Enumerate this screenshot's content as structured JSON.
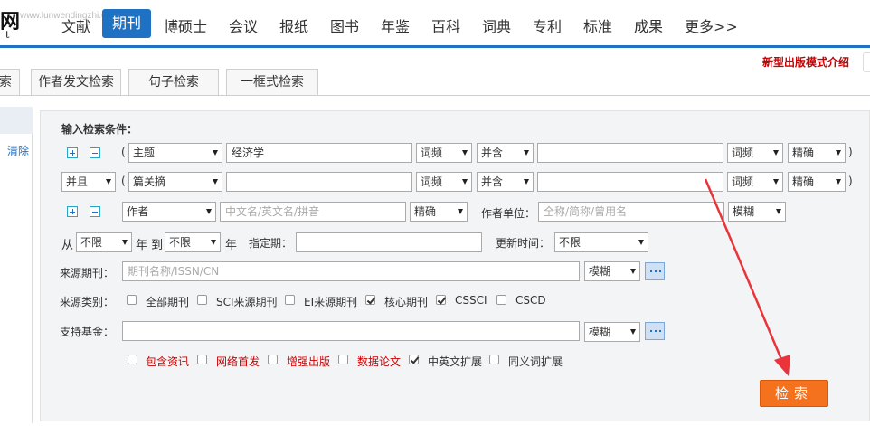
{
  "watermark": "www.lunwendingzhi.com",
  "logo": {
    "glyph": "网",
    "letter": "t"
  },
  "nav": {
    "items": [
      "文献",
      "期刊",
      "博硕士",
      "会议",
      "报纸",
      "图书",
      "年鉴",
      "百科",
      "词典",
      "专利",
      "标准",
      "成果",
      "更多>>"
    ],
    "active": "期刊"
  },
  "tabs": {
    "partial_left": "索",
    "items": [
      "作者发文检索",
      "句子检索",
      "一框式检索"
    ],
    "promo": "新型出版模式介绍"
  },
  "side": {
    "clear": "清除"
  },
  "form": {
    "title": "输入检索条件：",
    "row1": {
      "field": "主题",
      "value": "经济学",
      "freq1": "词频",
      "op": "并含",
      "freq2": "词频",
      "match": "精确"
    },
    "row2": {
      "logic": "并且",
      "field": "篇关摘",
      "freq1": "词频",
      "op": "并含",
      "freq2": "词频",
      "match": "精确"
    },
    "paren_open": "(",
    "paren_close": ")",
    "author_row": {
      "field": "作者",
      "name_placeholder": "中文名/英文名/拼音",
      "match": "精确",
      "unit_label": "作者单位：",
      "unit_placeholder": "全称/简称/曾用名",
      "unit_match": "模糊"
    },
    "time_row": {
      "from_label": "从",
      "from_value": "不限",
      "year_to": "年 到",
      "to_value": "不限",
      "year": "年",
      "period_label": "指定期：",
      "update_label": "更新时间：",
      "update_value": "不限"
    },
    "source_row": {
      "label": "来源期刊：",
      "placeholder": "期刊名称/ISSN/CN",
      "match": "模糊"
    },
    "category_row": {
      "label": "来源类别：",
      "options": [
        {
          "label": "全部期刊",
          "checked": false
        },
        {
          "label": "SCI来源期刊",
          "checked": false
        },
        {
          "label": "EI来源期刊",
          "checked": false
        },
        {
          "label": "核心期刊",
          "checked": true
        },
        {
          "label": "CSSCI",
          "checked": true
        },
        {
          "label": "CSCD",
          "checked": false
        }
      ]
    },
    "fund_row": {
      "label": "支持基金：",
      "match": "模糊"
    },
    "extra_options": [
      {
        "label": "包含资讯",
        "checked": false,
        "red": true
      },
      {
        "label": "网络首发",
        "checked": false,
        "red": true
      },
      {
        "label": "增强出版",
        "checked": false,
        "red": true
      },
      {
        "label": "数据论文",
        "checked": false,
        "red": true
      },
      {
        "label": "中英文扩展",
        "checked": true,
        "red": false
      },
      {
        "label": "同义词扩展",
        "checked": false,
        "red": false
      }
    ],
    "search_button": "检索"
  },
  "colors": {
    "accent": "#1f71c3",
    "button": "#f4721e",
    "annotation_arrow": "#e8343a",
    "warn": "#cc0000"
  }
}
